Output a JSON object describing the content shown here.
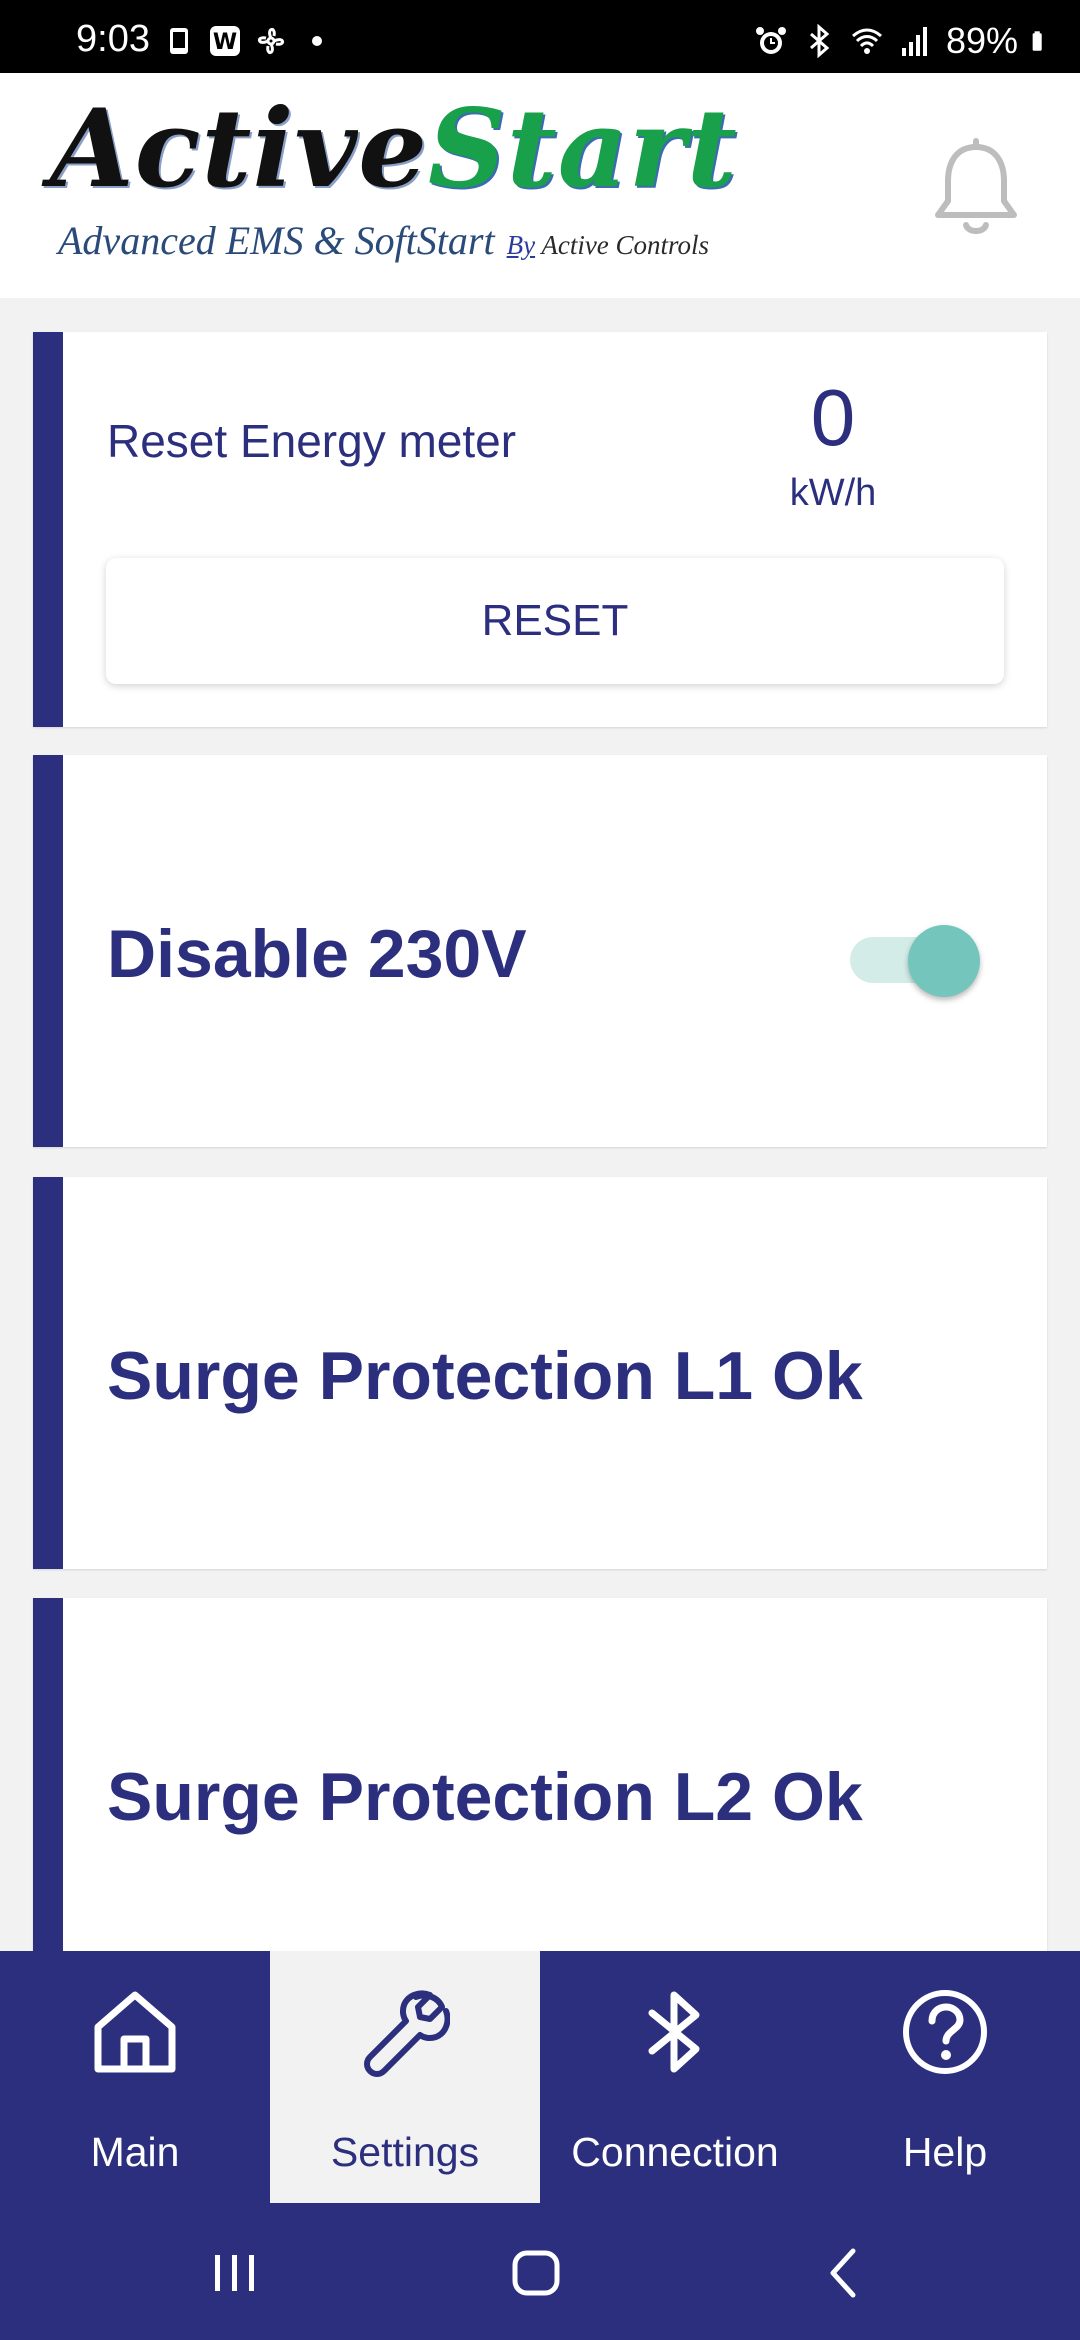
{
  "status_bar": {
    "time": "9:03",
    "battery": "89%",
    "left_icons": [
      "notification-icon",
      "w-app-icon",
      "fan-icon",
      "dot-icon"
    ],
    "right_icons": [
      "alarm-icon",
      "bluetooth-icon",
      "wifi-icon",
      "signal-icon",
      "battery-icon"
    ]
  },
  "header": {
    "logo_active": "Active",
    "logo_start": "Start",
    "logo_tagline": "Advanced EMS & SoftStart",
    "logo_by": "By",
    "logo_company": "Active Controls"
  },
  "cards": {
    "reset": {
      "label": "Reset Energy meter",
      "value": "0",
      "unit": "kW/h",
      "button_label": "RESET"
    },
    "disable_230v": {
      "label": "Disable 230V",
      "toggle_on": true
    },
    "surge_l1": {
      "label": "Surge Protection L1 Ok"
    },
    "surge_l2": {
      "label": "Surge Protection L2 Ok"
    }
  },
  "bottom_nav": {
    "items": [
      {
        "label": "Main",
        "icon": "home-icon"
      },
      {
        "label": "Settings",
        "icon": "wrench-icon",
        "selected": true
      },
      {
        "label": "Connection",
        "icon": "bluetooth-icon"
      },
      {
        "label": "Help",
        "icon": "help-icon"
      }
    ]
  },
  "colors": {
    "primary": "#2b2f7e",
    "accent": "#74c6bd",
    "logo_green": "#19a04b",
    "background": "#f2f2f2"
  }
}
